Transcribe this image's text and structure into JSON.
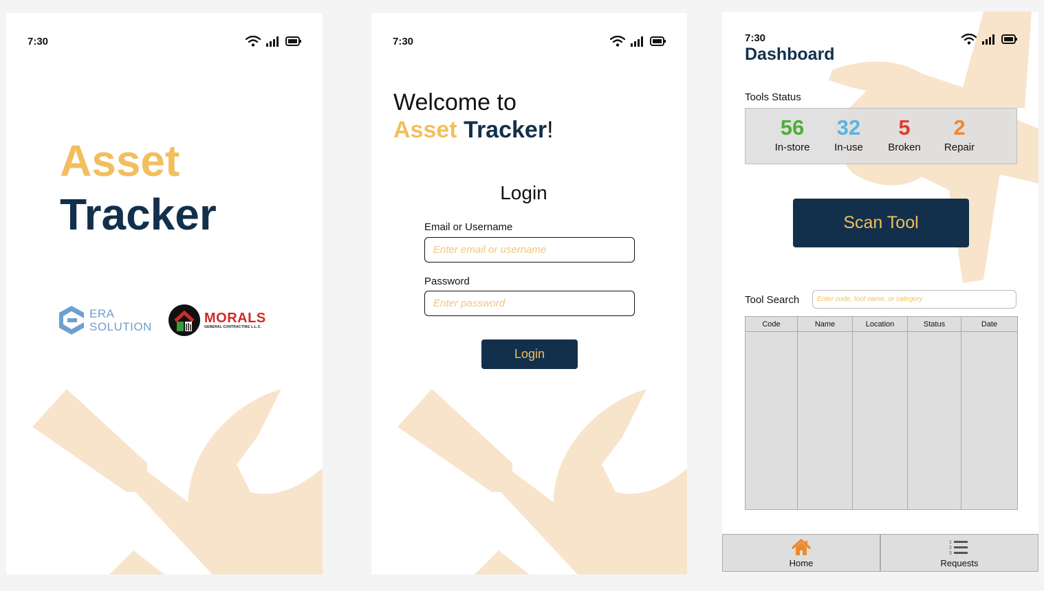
{
  "status_bar": {
    "time": "7:30"
  },
  "colors": {
    "brand_navy": "#12304b",
    "brand_gold": "#f2bf5e",
    "watermark": "#f8e4cb",
    "in_store": "#4caf37",
    "in_use": "#5ab4e0",
    "broken": "#e03b2e",
    "repair": "#ed8a2d"
  },
  "splash": {
    "title_line1": "Asset",
    "title_line2": "Tracker",
    "era_logo": {
      "line1": "ERA",
      "line2": "SOLUTION"
    },
    "morals_logo": {
      "name": "MORALS",
      "subtitle": "GENERAL CONTRACTING L.L.C."
    }
  },
  "login": {
    "welcome": "Welcome to",
    "brand_asset": "Asset",
    "brand_tracker": "Tracker",
    "exclaim": "!",
    "heading": "Login",
    "email_label": "Email or Username",
    "email_placeholder": "Enter email or username",
    "password_label": "Password",
    "password_placeholder": "Enter password",
    "button_label": "Login"
  },
  "dashboard": {
    "title": "Dashboard",
    "tools_status_label": "Tools Status",
    "stats": [
      {
        "value": "56",
        "label": "In-store"
      },
      {
        "value": "32",
        "label": "In-use"
      },
      {
        "value": "5",
        "label": "Broken"
      },
      {
        "value": "2",
        "label": "Repair"
      }
    ],
    "scan_button": "Scan Tool",
    "tool_search_label": "Tool Search",
    "search_placeholder": "Enter code, tool name, or category",
    "table_columns": [
      "Code",
      "Name",
      "Location",
      "Status",
      "Date"
    ],
    "nav": [
      {
        "label": "Home",
        "icon": "home-icon"
      },
      {
        "label": "Requests",
        "icon": "list-icon"
      }
    ]
  }
}
